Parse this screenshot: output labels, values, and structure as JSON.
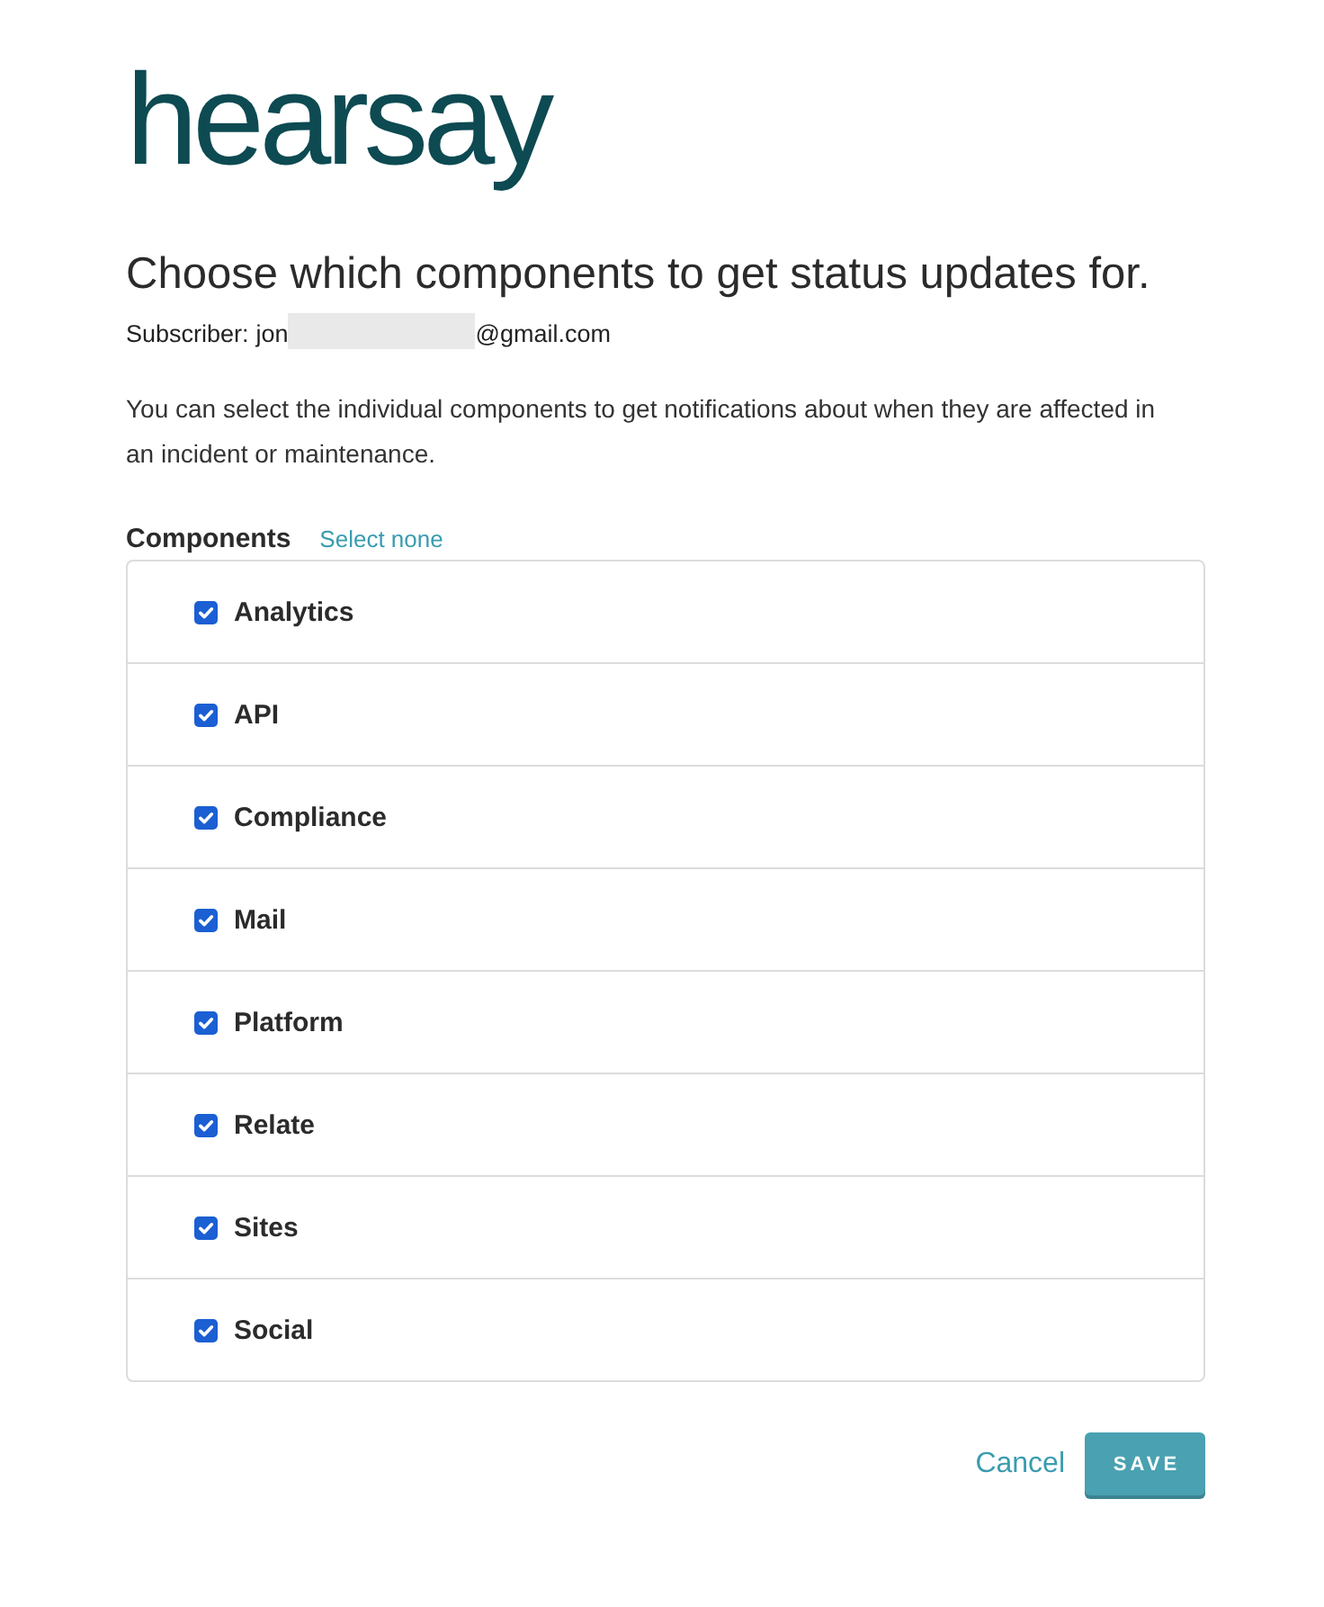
{
  "logo": {
    "text": "hearsay"
  },
  "heading": "Choose which components to get status updates for.",
  "subscriber": {
    "label": "Subscriber:",
    "email_start": "jon",
    "redacted": true,
    "email_end": "@gmail.com"
  },
  "description": "You can select the individual components to get notifications about when they are affected in an incident or maintenance.",
  "components": {
    "title": "Components",
    "select_link": "Select none",
    "items": [
      {
        "label": "Analytics",
        "checked": true
      },
      {
        "label": "API",
        "checked": true
      },
      {
        "label": "Compliance",
        "checked": true
      },
      {
        "label": "Mail",
        "checked": true
      },
      {
        "label": "Platform",
        "checked": true
      },
      {
        "label": "Relate",
        "checked": true
      },
      {
        "label": "Sites",
        "checked": true
      },
      {
        "label": "Social",
        "checked": true
      }
    ]
  },
  "actions": {
    "cancel": "Cancel",
    "save": "SAVE"
  }
}
